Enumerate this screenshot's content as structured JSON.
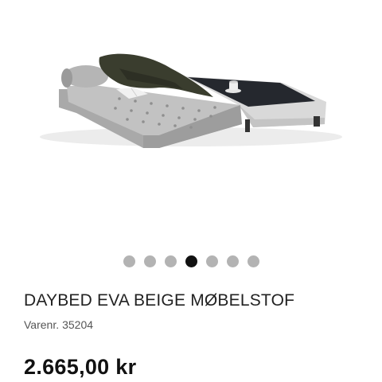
{
  "product": {
    "title": "DAYBED EVA BEIGE MØBELSTOF",
    "sku_label": "Varenr.",
    "sku_value": "35204",
    "price": "2.665,00 kr"
  },
  "carousel": {
    "total_slides": 7,
    "active_slide": 4
  },
  "image": {
    "subject": "daybed-with-blanket-book-and-cup"
  }
}
